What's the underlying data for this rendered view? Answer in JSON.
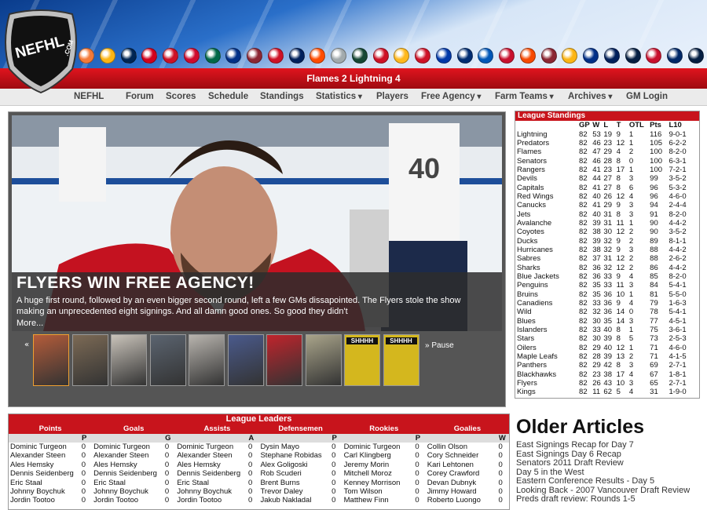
{
  "site": {
    "logo_text": "NEFHL",
    "logo_suffix": ".COM"
  },
  "team_logo_colors": [
    "#f47a38",
    "#fcb514",
    "#002654",
    "#d2001c",
    "#ce1126",
    "#cf0a2c",
    "#006847",
    "#003087",
    "#8c2633",
    "#ce1126",
    "#00205b",
    "#ff4c00",
    "#a2aaad",
    "#154734",
    "#ce1126",
    "#ffb81c",
    "#ce1126",
    "#0038a8",
    "#002d72",
    "#0057b8",
    "#c8102e",
    "#f74902",
    "#8c2633",
    "#fcb514",
    "#002f87",
    "#00205b",
    "#041e42",
    "#c8102e",
    "#002868",
    "#041e42"
  ],
  "scorebar": {
    "text": "Flames 2 Lightning 4"
  },
  "nav": [
    {
      "label": "NEFHL",
      "dropdown": false
    },
    {
      "label": "Forum",
      "dropdown": false
    },
    {
      "label": "Scores",
      "dropdown": false
    },
    {
      "label": "Schedule",
      "dropdown": false
    },
    {
      "label": "Standings",
      "dropdown": false
    },
    {
      "label": "Statistics",
      "dropdown": true
    },
    {
      "label": "Players",
      "dropdown": false
    },
    {
      "label": "Free Agency",
      "dropdown": true
    },
    {
      "label": "Farm Teams",
      "dropdown": true
    },
    {
      "label": "Archives",
      "dropdown": true
    },
    {
      "label": "GM Login",
      "dropdown": false
    }
  ],
  "feature": {
    "headline": "FLYERS WIN FREE AGENCY!",
    "summary": "A huge first round, followed by an even bigger second round, left a few GMs dissapointed. The Flyers stole the show making an unprecedented eight signings. And all damn good ones. So good they didn't",
    "more": "More...",
    "prev_symbol": "«",
    "next_symbol": "»",
    "pause_label": "Pause",
    "thumb_sign_text": "SHHHH"
  },
  "standings": {
    "title": "League Standings",
    "headers": [
      "",
      "GP",
      "W",
      "L",
      "T",
      "OTL",
      "Pts",
      "L10"
    ],
    "rows": [
      [
        "Lightning",
        "82",
        "53",
        "19",
        "9",
        "1",
        "116",
        "9-0-1"
      ],
      [
        "Predators",
        "82",
        "46",
        "23",
        "12",
        "1",
        "105",
        "6-2-2"
      ],
      [
        "Flames",
        "82",
        "47",
        "29",
        "4",
        "2",
        "100",
        "8-2-0"
      ],
      [
        "Senators",
        "82",
        "46",
        "28",
        "8",
        "0",
        "100",
        "6-3-1"
      ],
      [
        "Rangers",
        "82",
        "41",
        "23",
        "17",
        "1",
        "100",
        "7-2-1"
      ],
      [
        "Devils",
        "82",
        "44",
        "27",
        "8",
        "3",
        "99",
        "3-5-2"
      ],
      [
        "Capitals",
        "82",
        "41",
        "27",
        "8",
        "6",
        "96",
        "5-3-2"
      ],
      [
        "Red Wings",
        "82",
        "40",
        "26",
        "12",
        "4",
        "96",
        "4-6-0"
      ],
      [
        "Canucks",
        "82",
        "41",
        "29",
        "9",
        "3",
        "94",
        "2-4-4"
      ],
      [
        "Jets",
        "82",
        "40",
        "31",
        "8",
        "3",
        "91",
        "8-2-0"
      ],
      [
        "Avalanche",
        "82",
        "39",
        "31",
        "11",
        "1",
        "90",
        "4-4-2"
      ],
      [
        "Coyotes",
        "82",
        "38",
        "30",
        "12",
        "2",
        "90",
        "3-5-2"
      ],
      [
        "Ducks",
        "82",
        "39",
        "32",
        "9",
        "2",
        "89",
        "8-1-1"
      ],
      [
        "Hurricanes",
        "82",
        "38",
        "32",
        "9",
        "3",
        "88",
        "4-4-2"
      ],
      [
        "Sabres",
        "82",
        "37",
        "31",
        "12",
        "2",
        "88",
        "2-6-2"
      ],
      [
        "Sharks",
        "82",
        "36",
        "32",
        "12",
        "2",
        "86",
        "4-4-2"
      ],
      [
        "Blue Jackets",
        "82",
        "36",
        "33",
        "9",
        "4",
        "85",
        "8-2-0"
      ],
      [
        "Penguins",
        "82",
        "35",
        "33",
        "11",
        "3",
        "84",
        "5-4-1"
      ],
      [
        "Bruins",
        "82",
        "35",
        "36",
        "10",
        "1",
        "81",
        "5-5-0"
      ],
      [
        "Canadiens",
        "82",
        "33",
        "36",
        "9",
        "4",
        "79",
        "1-6-3"
      ],
      [
        "Wild",
        "82",
        "32",
        "36",
        "14",
        "0",
        "78",
        "5-4-1"
      ],
      [
        "Blues",
        "82",
        "30",
        "35",
        "14",
        "3",
        "77",
        "4-5-1"
      ],
      [
        "Islanders",
        "82",
        "33",
        "40",
        "8",
        "1",
        "75",
        "3-6-1"
      ],
      [
        "Stars",
        "82",
        "30",
        "39",
        "8",
        "5",
        "73",
        "2-5-3"
      ],
      [
        "Oilers",
        "82",
        "29",
        "40",
        "12",
        "1",
        "71",
        "4-6-0"
      ],
      [
        "Maple Leafs",
        "82",
        "28",
        "39",
        "13",
        "2",
        "71",
        "4-1-5"
      ],
      [
        "Panthers",
        "82",
        "29",
        "42",
        "8",
        "3",
        "69",
        "2-7-1"
      ],
      [
        "Blackhawks",
        "82",
        "23",
        "38",
        "17",
        "4",
        "67",
        "1-8-1"
      ],
      [
        "Flyers",
        "82",
        "26",
        "43",
        "10",
        "3",
        "65",
        "2-7-1"
      ],
      [
        "Kings",
        "82",
        "11",
        "62",
        "5",
        "4",
        "31",
        "1-9-0"
      ]
    ]
  },
  "leaders": {
    "title": "League Leaders",
    "categories": [
      {
        "name": "Points",
        "stat": "P",
        "players": [
          "Dominic Turgeon",
          "Alexander Steen",
          "Ales Hemsky",
          "Dennis Seidenberg",
          "Eric Staal",
          "Johnny Boychuk",
          "Jordin Tootoo"
        ],
        "values": [
          "0",
          "0",
          "0",
          "0",
          "0",
          "0",
          "0"
        ]
      },
      {
        "name": "Goals",
        "stat": "G",
        "players": [
          "Dominic Turgeon",
          "Alexander Steen",
          "Ales Hemsky",
          "Dennis Seidenberg",
          "Eric Staal",
          "Johnny Boychuk",
          "Jordin Tootoo"
        ],
        "values": [
          "0",
          "0",
          "0",
          "0",
          "0",
          "0",
          "0"
        ]
      },
      {
        "name": "Assists",
        "stat": "A",
        "players": [
          "Dominic Turgeon",
          "Alexander Steen",
          "Ales Hemsky",
          "Dennis Seidenberg",
          "Eric Staal",
          "Johnny Boychuk",
          "Jordin Tootoo"
        ],
        "values": [
          "0",
          "0",
          "0",
          "0",
          "0",
          "0",
          "0"
        ]
      },
      {
        "name": "Defensemen",
        "stat": "P",
        "players": [
          "Dysin Mayo",
          "Stephane Robidas",
          "Alex Goligoski",
          "Rob Scuderi",
          "Brent Burns",
          "Trevor Daley",
          "Jakub Nakladal"
        ],
        "values": [
          "0",
          "0",
          "0",
          "0",
          "0",
          "0",
          "0"
        ]
      },
      {
        "name": "Rookies",
        "stat": "P",
        "players": [
          "Dominic Turgeon",
          "Carl Klingberg",
          "Jeremy Morin",
          "Mitchell Moroz",
          "Kenney Morrison",
          "Tom Wilson",
          "Matthew Finn"
        ],
        "values": [
          "0",
          "0",
          "0",
          "0",
          "0",
          "0",
          "0"
        ]
      },
      {
        "name": "Goalies",
        "stat": "W",
        "players": [
          "Collin Olson",
          "Cory Schneider",
          "Kari Lehtonen",
          "Corey Crawford",
          "Devan Dubnyk",
          "Jimmy Howard",
          "Roberto Luongo"
        ],
        "values": [
          "0",
          "0",
          "0",
          "0",
          "0",
          "0",
          "0"
        ]
      }
    ]
  },
  "older_articles": {
    "title": "Older Articles",
    "items": [
      "East Signings Recap for Day 7",
      "East Signings Day 6 Recap",
      "Senators 2011 Draft Review",
      "Day 5 in the West",
      "Eastern Conference Results - Day 5",
      "Looking Back - 2007 Vancouver Draft Review",
      "Preds draft review: Rounds 1-5"
    ]
  }
}
